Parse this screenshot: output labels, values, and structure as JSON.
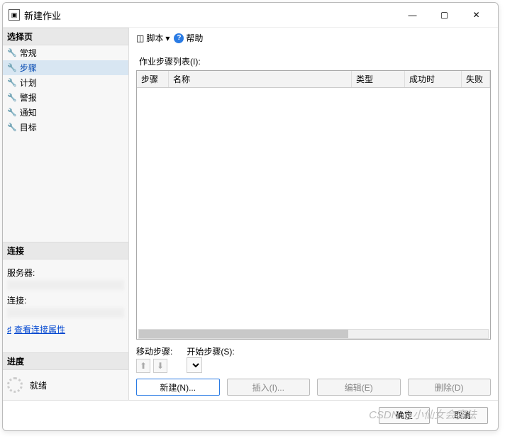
{
  "window": {
    "title": "新建作业"
  },
  "sidebar": {
    "select_page": "选择页",
    "nav": [
      "常规",
      "步骤",
      "计划",
      "警报",
      "通知",
      "目标"
    ],
    "connection_head": "连接",
    "server_label": "服务器:",
    "conn_label": "连接:",
    "view_conn_link": "查看连接属性",
    "progress_head": "进度",
    "status": "就绪"
  },
  "toolbar": {
    "script": "脚本",
    "help": "帮助"
  },
  "main": {
    "list_label": "作业步骤列表(I):",
    "columns": [
      "步骤",
      "名称",
      "类型",
      "成功时",
      "失败"
    ],
    "move_label": "移动步骤:",
    "start_label": "开始步骤(S):",
    "buttons": {
      "new": "新建(N)...",
      "insert": "插入(I)...",
      "edit": "编辑(E)",
      "delete": "删除(D)"
    }
  },
  "footer": {
    "ok": "确定",
    "cancel": "取消"
  },
  "watermark": "CSDN @小仙女会魔法"
}
